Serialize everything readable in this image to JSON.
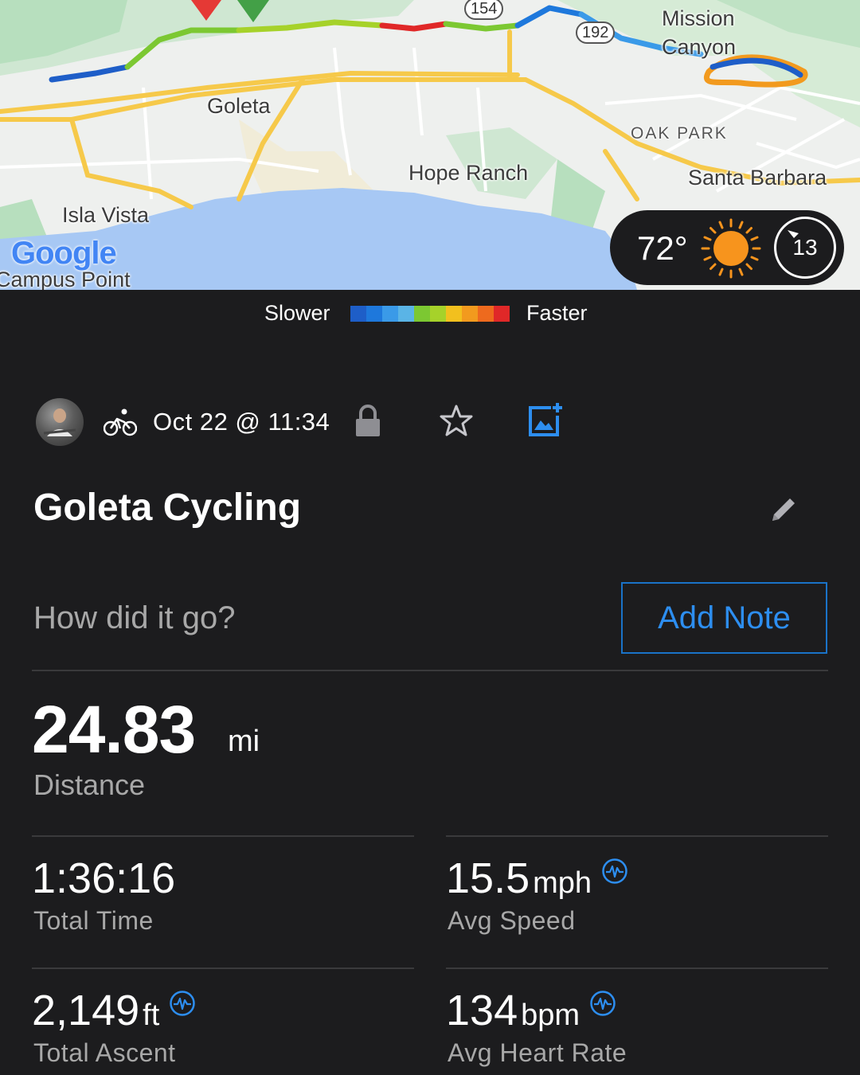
{
  "map": {
    "labels": {
      "goleta": "Goleta",
      "hope_ranch": "Hope Ranch",
      "isla_vista": "Isla Vista",
      "campus_point": "Campus Point",
      "mission": "Mission",
      "canyon": "Canyon",
      "oak_park": "OAK PARK",
      "santa_barbara": "Santa Barbara"
    },
    "shields": {
      "hwy154": "154",
      "hwy192": "192"
    },
    "logo": "Google",
    "weather": {
      "temperature": "72°",
      "wind_speed": "13",
      "icon": "sun-icon"
    }
  },
  "legend": {
    "slower": "Slower",
    "faster": "Faster",
    "colors": [
      "#1e5ec8",
      "#1e78dc",
      "#3a9ae8",
      "#5ab4e6",
      "#7cc832",
      "#a6d22a",
      "#f2c01e",
      "#f29a1e",
      "#ee6a1e",
      "#e02828"
    ]
  },
  "activity": {
    "type_icon": "bike-icon",
    "date": "Oct 22 @ 11:34",
    "title": "Goleta Cycling",
    "note_prompt": "How did it go?",
    "add_note_label": "Add Note"
  },
  "stats": {
    "distance": {
      "value": "24.83",
      "unit": "mi",
      "label": "Distance"
    },
    "total_time": {
      "value": "1:36:16",
      "label": "Total Time"
    },
    "avg_speed": {
      "value": "15.5",
      "unit": "mph",
      "label": "Avg Speed"
    },
    "total_ascent": {
      "value": "2,149",
      "unit": "ft",
      "label": "Total Ascent"
    },
    "avg_heart_rate": {
      "value": "134",
      "unit": "bpm",
      "label": "Avg Heart Rate"
    }
  },
  "colors": {
    "background": "#1c1c1e",
    "accent": "#2d8ef0",
    "secondary_text": "#a8a8a8"
  }
}
